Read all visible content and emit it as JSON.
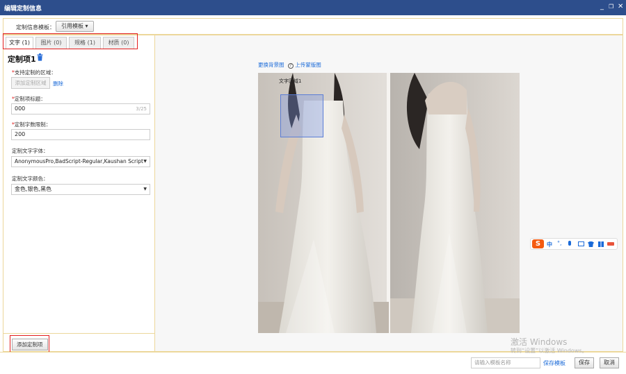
{
  "window": {
    "title": "编辑定制信息",
    "minimize": "_",
    "restore": "❐",
    "close": "✕"
  },
  "template_bar": {
    "label": "定制信息模板：",
    "button": "引用模板 ▾"
  },
  "tabs": [
    {
      "label": "文字 (1)"
    },
    {
      "label": "图片 (0)"
    },
    {
      "label": "规格 (1)"
    },
    {
      "label": "材质 (0)"
    }
  ],
  "item": {
    "title": "定制项1",
    "area": {
      "label": "*支持定制的区域：",
      "add_button": "添加定制区域",
      "delete_link": "删除"
    },
    "heading": {
      "label": "*定制项标题：",
      "value": "000",
      "counter": "3/25"
    },
    "limit": {
      "label": "*定制字数限制：",
      "value": "200"
    },
    "font": {
      "label": "定制文字字体：",
      "value": "AnonymousPro,BadScript-Regular,Kaushan Script"
    },
    "color": {
      "label": "定制文字颜色：",
      "value": "金色,银色,黑色"
    }
  },
  "add_item_button": "添加定制项",
  "image_panel": {
    "change_bg": "更换背景图",
    "help_icon": "?",
    "upload_template": "上传蒙版图",
    "area_label": "文字区域1"
  },
  "ime": {
    "logo": "S",
    "mode": "中",
    "punct": "°,",
    "icons": [
      "mic-icon",
      "keyboard-icon",
      "skin-icon",
      "grid-icon",
      "tool-icon"
    ]
  },
  "footer": {
    "template_name_placeholder": "请输入模板名称",
    "save_template": "保存模板",
    "save": "保存",
    "cancel": "取消"
  },
  "watermark": {
    "line1": "激活 Windows",
    "line2": "转到“设置”以激活 Windows。"
  },
  "colors": {
    "titlebar": "#2d4e8c",
    "highlight": "#e21d1d",
    "link": "#1a6ad8",
    "panel_border": "#ecd79a"
  }
}
